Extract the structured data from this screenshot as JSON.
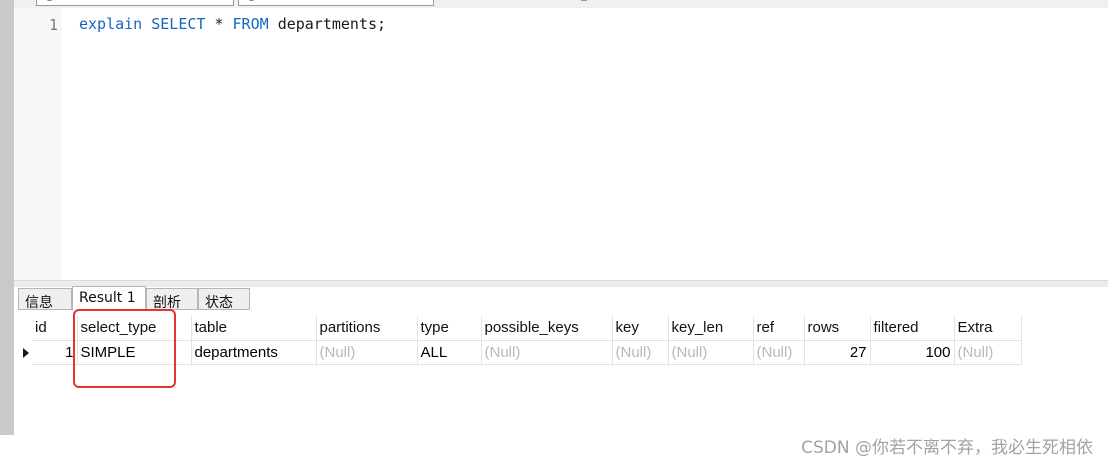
{
  "editor": {
    "line_number": "1",
    "kw_explain": "explain",
    "kw_select": "SELECT",
    "star": "*",
    "kw_from": "FROM",
    "rest": "departments;"
  },
  "result_tabs": [
    "信息",
    "Result 1",
    "剖析",
    "状态"
  ],
  "columns": [
    "id",
    "select_type",
    "table",
    "partitions",
    "type",
    "possible_keys",
    "key",
    "key_len",
    "ref",
    "rows",
    "filtered",
    "Extra"
  ],
  "rows": [
    [
      "1",
      "SIMPLE",
      "departments",
      "(Null)",
      "ALL",
      "(Null)",
      "(Null)",
      "(Null)",
      "(Null)",
      "27",
      "100",
      "(Null)"
    ]
  ],
  "watermark": "CSDN @你若不离不弃，我必生死相依",
  "colors": {
    "keyword": "#1565c0",
    "null_text": "#b9b9b9",
    "highlight": "#e23434"
  }
}
